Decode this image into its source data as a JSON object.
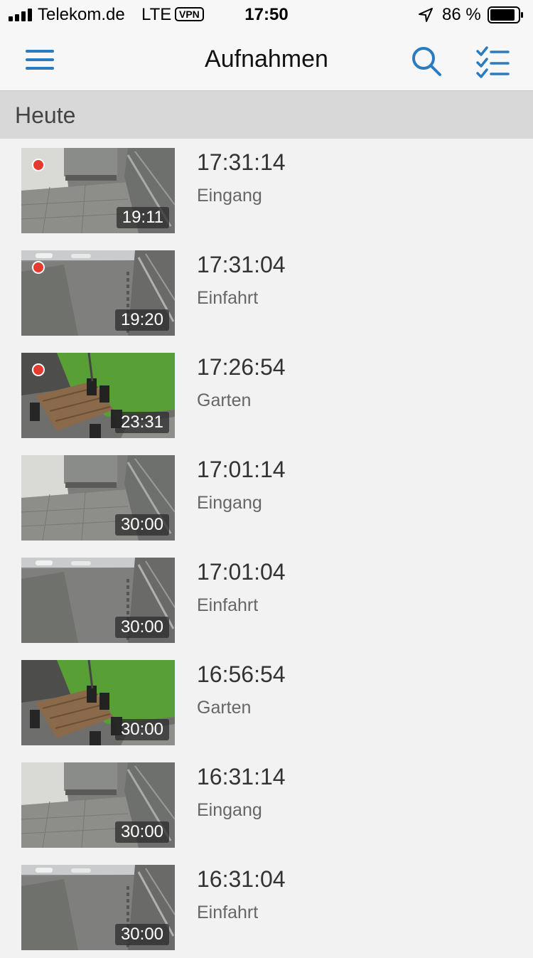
{
  "status_bar": {
    "carrier": "Telekom.de",
    "network": "LTE",
    "vpn": "VPN",
    "time": "17:50",
    "battery": "86 %",
    "icons": [
      "signal-icon",
      "location-arrow-icon",
      "battery-icon"
    ]
  },
  "nav": {
    "title": "Aufnahmen",
    "icons": [
      "menu-icon",
      "search-icon",
      "checklist-icon"
    ],
    "accent": "#2a7bbf"
  },
  "section": {
    "title": "Heute"
  },
  "recording_dot_color": "#e53a2f",
  "recordings": [
    {
      "time": "17:31:14",
      "camera": "Eingang",
      "duration": "19:11",
      "new": true,
      "scene": "eingang"
    },
    {
      "time": "17:31:04",
      "camera": "Einfahrt",
      "duration": "19:20",
      "new": true,
      "scene": "einfahrt"
    },
    {
      "time": "17:26:54",
      "camera": "Garten",
      "duration": "23:31",
      "new": true,
      "scene": "garten"
    },
    {
      "time": "17:01:14",
      "camera": "Eingang",
      "duration": "30:00",
      "new": false,
      "scene": "eingang"
    },
    {
      "time": "17:01:04",
      "camera": "Einfahrt",
      "duration": "30:00",
      "new": false,
      "scene": "einfahrt"
    },
    {
      "time": "16:56:54",
      "camera": "Garten",
      "duration": "30:00",
      "new": false,
      "scene": "garten"
    },
    {
      "time": "16:31:14",
      "camera": "Eingang",
      "duration": "30:00",
      "new": false,
      "scene": "eingang"
    },
    {
      "time": "16:31:04",
      "camera": "Einfahrt",
      "duration": "30:00",
      "new": false,
      "scene": "einfahrt"
    }
  ]
}
